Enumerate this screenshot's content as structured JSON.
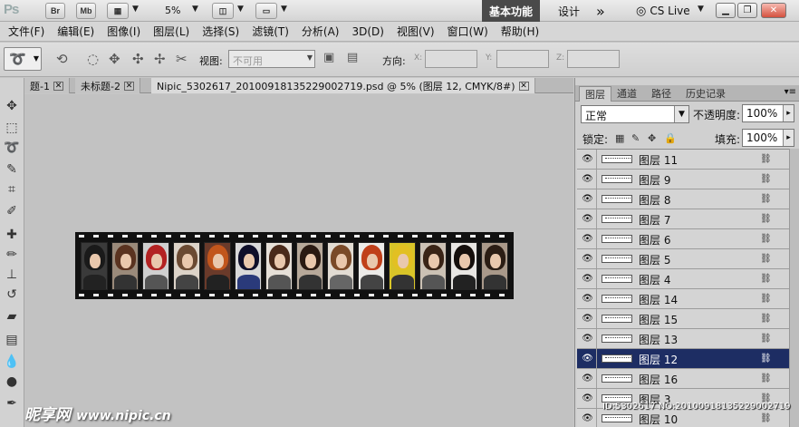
{
  "appbar": {
    "logo": "Ps",
    "br": "Br",
    "mb": "Mb",
    "zoom": "5%",
    "workspaces": [
      "基本功能",
      "设计"
    ],
    "more": "»",
    "cslive": "CS Live"
  },
  "menu": [
    "文件(F)",
    "编辑(E)",
    "图像(I)",
    "图层(L)",
    "选择(S)",
    "滤镜(T)",
    "分析(A)",
    "3D(D)",
    "视图(V)",
    "窗口(W)",
    "帮助(H)"
  ],
  "options": {
    "view_label": "视图:",
    "view_value": "不可用",
    "direction_label": "方向:",
    "x": "X:",
    "y": "Y:",
    "z": "Z:"
  },
  "tabs": [
    {
      "label": "题-1"
    },
    {
      "label": "未标题-2"
    },
    {
      "label": "Nipic_5302617_20100918135229002719.psd @ 5% (图层 12, CMYK/8#)"
    }
  ],
  "panel": {
    "tabs": [
      "图层",
      "通道",
      "路径",
      "历史记录"
    ],
    "blend_mode": "正常",
    "opacity_label": "不透明度:",
    "opacity": "100%",
    "lock_label": "锁定:",
    "fill_label": "填充:",
    "fill": "100%",
    "layers": [
      {
        "name": "图层 11",
        "selected": false
      },
      {
        "name": "图层 9",
        "selected": false
      },
      {
        "name": "图层 8",
        "selected": false
      },
      {
        "name": "图层 7",
        "selected": false
      },
      {
        "name": "图层 6",
        "selected": false
      },
      {
        "name": "图层 5",
        "selected": false
      },
      {
        "name": "图层 4",
        "selected": false
      },
      {
        "name": "图层 14",
        "selected": false
      },
      {
        "name": "图层 15",
        "selected": false
      },
      {
        "name": "图层 13",
        "selected": false
      },
      {
        "name": "图层 12",
        "selected": true
      },
      {
        "name": "图层 16",
        "selected": false
      },
      {
        "name": "图层 3",
        "selected": false
      },
      {
        "name": "图层 10",
        "selected": false
      }
    ]
  },
  "filmstrip": {
    "frames": [
      {
        "hair": "#1a1a1a",
        "bg": "#3a3a3a",
        "cloth": "#222"
      },
      {
        "hair": "#5a3320",
        "bg": "#9a8a7a",
        "cloth": "#333"
      },
      {
        "hair": "#b32222",
        "bg": "#cfcfcf",
        "cloth": "#555"
      },
      {
        "hair": "#6b4a32",
        "bg": "#dcd3c8",
        "cloth": "#444"
      },
      {
        "hair": "#c2561c",
        "bg": "#6a3a2a",
        "cloth": "#222"
      },
      {
        "hair": "#0f0f2a",
        "bg": "#d9d9d9",
        "cloth": "#2a3a7a"
      },
      {
        "hair": "#4a2a1a",
        "bg": "#e6e0d8",
        "cloth": "#555"
      },
      {
        "hair": "#2a1a12",
        "bg": "#b7a99a",
        "cloth": "#333"
      },
      {
        "hair": "#7a4a28",
        "bg": "#e2dcd3",
        "cloth": "#666"
      },
      {
        "hair": "#c0401a",
        "bg": "#ecebe8",
        "cloth": "#444"
      },
      {
        "hair": "#e2c022",
        "bg": "#d8c428",
        "cloth": "#333"
      },
      {
        "hair": "#3a2416",
        "bg": "#cbc1b4",
        "cloth": "#555"
      },
      {
        "hair": "#150f0c",
        "bg": "#e8e6e3",
        "cloth": "#222"
      },
      {
        "hair": "#2b1d14",
        "bg": "#a9998a",
        "cloth": "#333"
      }
    ]
  },
  "watermark": {
    "brand": "昵享网",
    "url": "www.nipic.cn"
  },
  "image_id": "ID:5302617 NO:20100918135229002719"
}
